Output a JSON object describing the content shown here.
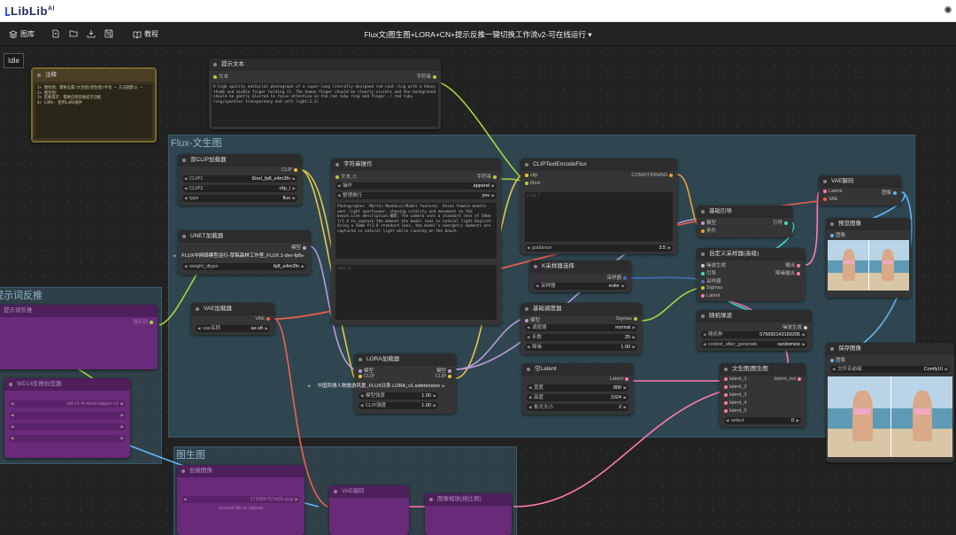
{
  "logo": {
    "text": "LibLib",
    "sup": "AI"
  },
  "toolbar": {
    "gallery_label": "图库",
    "tutorial_label": "教程",
    "workflow_title": "Flux文|图生图+LORA+CN+提示反推一键切换工作流v2-可在线运行",
    "title_chevron": "▾"
  },
  "status": "Idle",
  "groups": {
    "flux_t2i": "Flux-文生图",
    "prompt_reverse": "提示词反推",
    "img2img": "图生图"
  },
  "nodes": {
    "note": {
      "title": "注释",
      "lines": [
        "1> 图生图：需要设置(文生图|图生图)手动 ~ 方法图默认 ~",
        "2> 图生图：",
        "3> 反推提示：需要启用反推提示功能",
        "4> LORA: 使用LoRA插件"
      ]
    },
    "prompt": {
      "title": "提示文本",
      "in": "文本",
      "out": "字符串",
      "text": "A high quality editorial photograph of a super-long literally designed red coat ring with a heavy thumb and middle finger holding it. The human finger should be clearly visible and the background should be gently blurred to focus attention on the red ruby ring and finger. / red ruby ring/sparkle/ transparency and soft light:1.2)"
    },
    "dual_clip": {
      "title": "双CLIP加载器",
      "out": "CLIP",
      "w": [
        [
          "CLIP1",
          "t5xxl_fp8_e4m3fn"
        ],
        [
          "CLIP2",
          "clip_l"
        ],
        [
          "type",
          "flux"
        ]
      ]
    },
    "unet": {
      "title": "UNET加载器",
      "out": "模型",
      "w": [
        [
          "",
          "FLUX中网络模型运行-草稿森林工作室_FLUX.1-dev-fp8"
        ],
        [
          "weight_dtype",
          "fp8_e4m3fn"
        ]
      ]
    },
    "vae_loader": {
      "title": "VAE加载器",
      "out": "VAE",
      "w": [
        [
          "vae名称",
          "ae.sft"
        ]
      ]
    },
    "str_op": {
      "title": "字符串操作",
      "in": "文本_C",
      "out": "字符串",
      "w": [
        [
          "操作",
          "append"
        ],
        [
          "整理换行",
          "yes"
        ]
      ],
      "text": "Photographer  Martin Munkácsi/Model features  Asian female models wear light sportswear, showing vitality and movement on the beach.Line description:摄影：The camera uses a standard lens of 50mm f/1.8 to capture the moment the model runs in natural light.English: Using a 50mm f/1.8 standard lens, the model's energetic moments are captured in natural light while running on the beach.",
      "text2": "text_b"
    },
    "clip_encode": {
      "title": "CLIPTextEncodeFlux",
      "in": [
        "clip",
        "t5xxl"
      ],
      "out": "CONDITIONING",
      "ph": "clip_l",
      "w": [
        [
          "guidance",
          "3.5"
        ]
      ]
    },
    "lora": {
      "title": "LORA加载器",
      "in": [
        "模型",
        "CLIP"
      ],
      "out": [
        "模型",
        "CLIP"
      ],
      "w": [
        [
          "",
          "中国风情人物旅游风景_FLUX日系 LORA_v1.safetensors"
        ],
        [
          "模型强度",
          "1.00"
        ],
        [
          "CLIP强度",
          "1.00"
        ]
      ]
    },
    "ksampler_sel": {
      "title": "K采样器选择",
      "out": "采样器",
      "w": [
        [
          "采样器",
          "euler"
        ]
      ]
    },
    "basic_sched": {
      "title": "基础调度器",
      "in": "模型",
      "out": "Sigmas",
      "w": [
        [
          "调度器",
          "normal"
        ],
        [
          "步数",
          "25"
        ],
        [
          "降噪",
          "1.00"
        ]
      ]
    },
    "empty_latent": {
      "title": "空Latent",
      "out": "Latent",
      "w": [
        [
          "宽度",
          "800"
        ],
        [
          "高度",
          "1024"
        ],
        [
          "批次大小",
          "2"
        ]
      ]
    },
    "guider": {
      "title": "基础引导",
      "in": [
        "模型",
        "条件"
      ],
      "out": "引导"
    },
    "custom_sampler": {
      "title": "自定义采样器(高级)",
      "in": [
        "噪波生成",
        "引导",
        "采样器",
        "Sigmas",
        "Latent"
      ],
      "out": [
        "输出",
        "降噪输出"
      ]
    },
    "noise": {
      "title": "随机噪波",
      "out": "噪波生成",
      "w": [
        [
          "随机种",
          "575665143169205"
        ],
        [
          "control_after_generate",
          "randomize"
        ]
      ]
    },
    "t2i_switch": {
      "title": "文生图|图生图",
      "in": [
        "latent_1",
        "latent_2",
        "latent_3",
        "latent_4",
        "latent_5"
      ],
      "out": "latent_out",
      "w": [
        [
          "select",
          "0"
        ]
      ]
    },
    "vae_decode": {
      "title": "VAE解码",
      "in": [
        "Latent",
        "VAE"
      ],
      "out": "图像"
    },
    "preview": {
      "title": "预览图像",
      "in": "图像"
    },
    "save": {
      "title": "保存图像",
      "in": "图像",
      "w": [
        [
          "文件名前缀",
          "ComfyUI"
        ]
      ]
    },
    "purple1": {
      "title": "提示词反推",
      "out": "提示词"
    },
    "purple2": {
      "title": "WD14反推标签器",
      "w": [
        [
          "",
          "wd-v1-4-moat-tagger-v2"
        ],
        [
          "",
          ""
        ],
        [
          "",
          ""
        ],
        [
          "",
          ""
        ]
      ]
    },
    "purple3": {
      "title": "加载图像",
      "w": [
        [
          "",
          "1732847574ZD.png"
        ]
      ],
      "extra": "choose file to upload"
    },
    "purple4": {
      "title": "VAE编码"
    },
    "purple5": {
      "title": "图像缩放(按比例)"
    }
  },
  "colors": {
    "bg": "#222222",
    "node": "#353535",
    "group": "#3a6478",
    "purple": "#6a2a7a"
  }
}
